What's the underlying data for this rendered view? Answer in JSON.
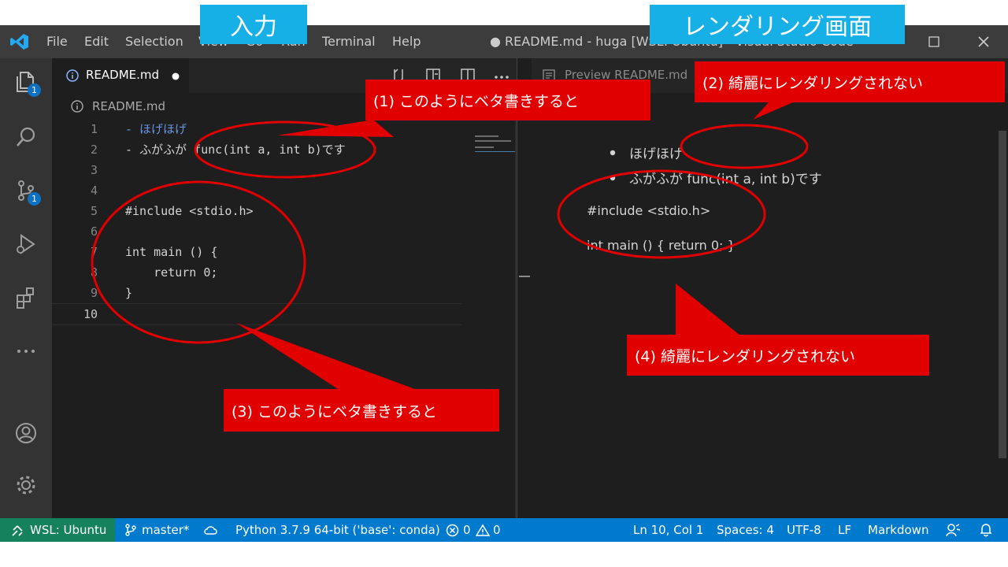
{
  "labels": {
    "input": "入力",
    "rendering": "レンダリング画面"
  },
  "menu": {
    "file": "File",
    "edit": "Edit",
    "selection": "Selection",
    "view": "View",
    "go": "Go",
    "run": "Run",
    "terminal": "Terminal",
    "help": "Help"
  },
  "window_title": "● README.md - huga [WSL: Ubuntu] - Visual Studio Code",
  "activity_badges": {
    "explorer": "1",
    "scm": "1"
  },
  "editor": {
    "tab_label": "README.md",
    "breadcrumb": "README.md",
    "lines": [
      {
        "num": "1",
        "text": "- ほげほげ"
      },
      {
        "num": "2",
        "text": "- ふがふが func(int a, int b)です"
      },
      {
        "num": "3",
        "text": ""
      },
      {
        "num": "4",
        "text": ""
      },
      {
        "num": "5",
        "text": "#include <stdio.h>"
      },
      {
        "num": "6",
        "text": ""
      },
      {
        "num": "7",
        "text": "int main () {"
      },
      {
        "num": "8",
        "text": "    return 0;"
      },
      {
        "num": "9",
        "text": "}"
      },
      {
        "num": "10",
        "text": ""
      }
    ]
  },
  "preview": {
    "tab_label": "Preview README.md",
    "bullets": [
      "ほげほげ",
      "ふがふが func(int a, int b)です"
    ],
    "para1": "#include <stdio.h>",
    "para2": "int main () { return 0; }"
  },
  "status": {
    "remote": "WSL: Ubuntu",
    "branch": "master*",
    "python": "Python 3.7.9 64-bit ('base': conda)",
    "errors": "0",
    "warnings": "0",
    "position": "Ln 10, Col 1",
    "spaces": "Spaces: 4",
    "encoding": "UTF-8",
    "eol": "LF",
    "language": "Markdown"
  },
  "callouts": {
    "c1": "(1) このようにベタ書きすると",
    "c2": "(2) 綺麗にレンダリングされない",
    "c3": "(3) このようにベタ書きすると",
    "c4": "(4) 綺麗にレンダリングされない"
  },
  "colors": {
    "accent": "#007acc",
    "remote": "#16825d",
    "callout": "#e00000",
    "header_label": "#17b0e6"
  }
}
